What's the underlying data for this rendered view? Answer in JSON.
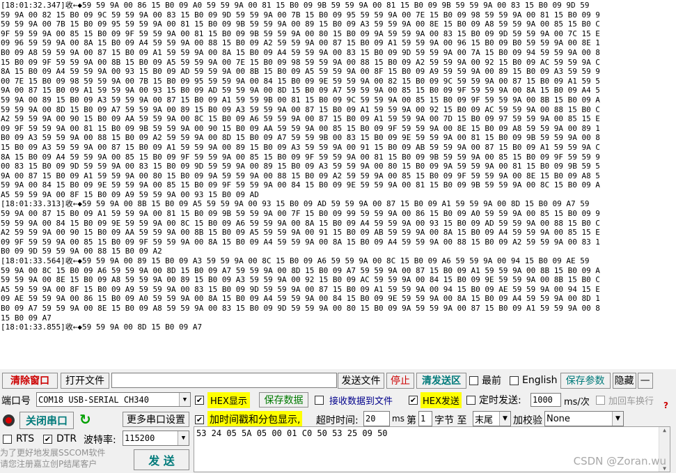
{
  "receive_log": [
    "[18:01:32.347]收←◆59 59 9A 00 86 15 B0 09 A0 59 59 9A 00 81 15 B0 09 9B 59 59 9A 00 81 15 B0 09 9B 59 59 9A 00 83 15 B0 09 9D 59",
    "59 9A 00 82 15 B0 09 9C 59 59 9A 00 83 15 B0 09 9D 59 59 9A 00 7B 15 B0 09 95 59 59 9A 00 7E 15 B0 09 98 59 59 9A 00 81 15 B0 09 9",
    "59 59 9A 00 7B 15 B0 09 95 59 59 9A 00 81 15 B0 09 9B 59 59 9A 00 89 15 B0 09 A3 59 59 9A 00 8E 15 B0 09 A8 59 59 9A 00 85 15 B0 C",
    "9F 59 59 9A 00 85 15 B0 09 9F 59 59 9A 00 81 15 B0 09 9B 59 59 9A 00 80 15 B0 09 9A 59 59 9A 00 83 15 B0 09 9D 59 59 9A 00 7C 15 E",
    "09 96 59 59 9A 00 8A 15 B0 09 A4 59 59 9A 00 88 15 B0 09 A2 59 59 9A 00 87 15 B0 09 A1 59 59 9A 00 96 15 B0 09 B0 59 59 9A 00 8E 1",
    "B0 09 A8 59 59 9A 00 87 15 B0 09 A1 59 59 9A 00 8A 15 B0 09 A4 59 59 9A 00 83 15 B0 09 9D 59 59 9A 00 7A 15 B0 09 94 59 59 9A 00 8",
    "15 B0 09 9F 59 59 9A 00 8B 15 B0 09 A5 59 59 9A 00 7E 15 B0 09 98 59 59 9A 00 88 15 B0 09 A2 59 59 9A 00 92 15 B0 09 AC 59 59 9A C",
    "8A 15 B0 09 A4 59 59 9A 00 93 15 B0 09 AD 59 59 9A 00 8B 15 B0 09 A5 59 59 9A 00 8F 15 B0 09 A9 59 59 9A 00 89 15 B0 09 A3 59 59 9",
    "00 7E 15 B0 09 98 59 59 9A 00 7B 15 B0 09 95 59 59 9A 00 84 15 B0 09 9E 59 59 9A 00 82 15 B0 09 9C 59 59 9A 00 87 15 B0 09 A1 59 5",
    "9A 00 87 15 B0 09 A1 59 59 9A 00 93 15 B0 09 AD 59 59 9A 00 8D 15 B0 09 A7 59 59 9A 00 85 15 B0 09 9F 59 59 9A 00 8A 15 B0 09 A4 5",
    "59 9A 00 89 15 B0 09 A3 59 59 9A 00 87 15 B0 09 A1 59 59 9B 00 81 15 B0 09 9C 59 59 9A 00 85 15 B0 09 9F 59 59 9A 00 8B 15 B0 09 A",
    "59 59 9A 00 8D 15 B0 09 A7 59 59 9A 00 89 15 B0 09 A3 59 59 9A 00 87 15 B0 09 A1 59 59 9A 00 92 15 B0 09 AC 59 59 9A 00 88 15 B0 C",
    "A2 59 59 9A 00 90 15 B0 09 AA 59 59 9A 00 8C 15 B0 09 A6 59 59 9A 00 87 15 B0 09 A1 59 59 9A 00 7D 15 B0 09 97 59 59 9A 00 85 15 E",
    "09 9F 59 59 9A 00 81 15 B0 09 9B 59 59 9A 00 90 15 B0 09 AA 59 59 9A 00 85 15 B0 09 9F 59 59 9A 00 8E 15 B0 09 A8 59 59 9A 00 89 1",
    "B0 09 A3 59 59 9A 00 88 15 B0 09 A2 59 59 9A 00 8D 15 B0 09 A7 59 59 9B 00 83 15 B0 09 9E 59 59 9A 00 81 15 B0 09 9B 59 59 9A 00 8",
    "15 B0 09 A3 59 59 9A 00 87 15 B0 09 A1 59 59 9A 00 89 15 B0 09 A3 59 59 9A 00 91 15 B0 09 AB 59 59 9A 00 87 15 B0 09 A1 59 59 9A C",
    "8A 15 B0 09 A4 59 59 9A 00 85 15 B0 09 9F 59 59 9A 00 85 15 B0 09 9F 59 59 9A 00 81 15 B0 09 9B 59 59 9A 00 85 15 B0 09 9F 59 59 9",
    "00 83 15 B0 09 9D 59 59 9A 00 83 15 B0 09 9D 59 59 9A 00 89 15 B0 09 A3 59 59 9A 00 80 15 B0 09 9A 59 59 9A 00 81 15 B0 09 9B 59 5",
    "9A 00 87 15 B0 09 A1 59 59 9A 00 80 15 B0 09 9A 59 59 9A 00 88 15 B0 09 A2 59 59 9A 00 85 15 B0 09 9F 59 59 9A 00 8E 15 B0 09 A8 5",
    "59 9A 00 84 15 B0 09 9E 59 59 9A 00 85 15 B0 09 9F 59 59 9A 00 84 15 B0 09 9E 59 59 9A 00 81 15 B0 09 9B 59 59 9A 00 8C 15 B0 09 A",
    "A5 59 59 9A 00 8F 15 B0 09 A9 59 59 9A 00 93 15 B0 09 AD",
    "[18:01:33.313]收←◆59 59 9A 00 8B 15 B0 09 A5 59 59 9A 00 93 15 B0 09 AD 59 59 9A 00 87 15 B0 09 A1 59 59 9A 00 8D 15 B0 09 A7 59",
    "59 9A 00 87 15 B0 09 A1 59 59 9A 00 81 15 B0 09 9B 59 59 9A 00 7F 15 B0 09 99 59 59 9A 00 86 15 B0 09 A0 59 59 9A 00 85 15 B0 09 9",
    "59 59 9A 00 84 15 B0 09 9E 59 59 9A 00 8C 15 B0 09 A6 59 59 9A 00 8A 15 B0 09 A4 59 59 9A 00 93 15 B0 09 AD 59 59 9A 00 88 15 B0 C",
    "A2 59 59 9A 00 90 15 B0 09 AA 59 59 9A 00 8B 15 B0 09 A5 59 59 9A 00 91 15 B0 09 AB 59 59 9A 00 8A 15 B0 09 A4 59 59 9A 00 85 15 E",
    "09 9F 59 59 9A 00 85 15 B0 09 9F 59 59 9A 00 8A 15 B0 09 A4 59 59 9A 00 8A 15 B0 09 A4 59 59 9A 00 88 15 B0 09 A2 59 59 9A 00 83 1",
    "B0 09 9D 59 59 9A 00 88 15 B0 09 A2",
    "[18:01:33.564]收←◆59 59 9A 00 89 15 B0 09 A3 59 59 9A 00 8C 15 B0 09 A6 59 59 9A 00 8C 15 B0 09 A6 59 59 9A 00 94 15 B0 09 AE 59",
    "59 9A 00 8C 15 B0 09 A6 59 59 9A 00 8D 15 B0 09 A7 59 59 9A 00 8D 15 B0 09 A7 59 59 9A 00 87 15 B0 09 A1 59 59 9A 00 8B 15 B0 09 A",
    "59 59 9A 00 8E 15 B0 09 A8 59 59 9A 00 89 15 B0 09 A3 59 59 9A 00 92 15 B0 09 AC 59 59 9A 00 84 15 B0 09 9E 59 59 9A 00 8B 15 B0 C",
    "A5 59 59 9A 00 8F 15 B0 09 A9 59 59 9A 00 83 15 B0 09 9D 59 59 9A 00 87 15 B0 09 A1 59 59 9A 00 94 15 B0 09 AE 59 59 9A 00 94 15 E",
    "09 AE 59 59 9A 00 86 15 B0 09 A0 59 59 9A 00 8A 15 B0 09 A4 59 59 9A 00 84 15 B0 09 9E 59 59 9A 00 8A 15 B0 09 A4 59 59 9A 00 8D 1",
    "B0 09 A7 59 59 9A 00 8E 15 B0 09 A8 59 59 9A 00 83 15 B0 09 9D 59 59 9A 00 80 15 B0 09 9A 59 59 9A 00 87 15 B0 09 A1 59 59 9A 00 8",
    "15 B0 09 A7",
    "[18:01:33.855]收←◆59 59 9A 00 8D 15 B0 09 A7"
  ],
  "toolbar": {
    "clear_window": "清除窗口",
    "open_file": "打开文件",
    "send_file": "发送文件",
    "stop": "停止",
    "clear_send": "清发送区",
    "topmost": "最前",
    "english": "English",
    "save_params": "保存参数",
    "hide": "隐藏",
    "collapse": "—"
  },
  "port": {
    "label": "端口号",
    "value": "COM18 USB-SERIAL CH340",
    "hex_display": "HEX显示",
    "save_data": "保存数据",
    "recv_to_file": "接收数据到文件",
    "hex_send": "HEX发送",
    "timed_send": "定时发送:",
    "interval": "1000",
    "interval_unit": "ms/次",
    "append_crlf": "加回车换行"
  },
  "controls": {
    "close_port": "关闭串口",
    "more_settings": "更多串口设置",
    "timestamp_split": "加时间戳和分包显示,",
    "timeout_label": "超时时间:",
    "timeout_value": "20",
    "timeout_unit": "ms",
    "byte_prefix": "第",
    "byte_index": "1",
    "byte_suffix": "字节 至",
    "range_end": "末尾",
    "checksum_label": "加校验",
    "checksum_value": "None",
    "rts": "RTS",
    "dtr": "DTR",
    "baud_label": "波特率:",
    "baud_value": "115200",
    "send": "发 送"
  },
  "send_data": "53 24 05 5A 05 00 01 C0 50 53 25 09 50",
  "promo": {
    "line1": "为了更好地发展SSCOM软件",
    "line2": "请您注册嘉立创P结尾客户"
  },
  "watermark": "CSDN @Zoran.wu",
  "colors": {
    "accent_red": "#cc0000",
    "accent_teal": "#007a7a",
    "highlight_yellow": "#ffff00"
  }
}
